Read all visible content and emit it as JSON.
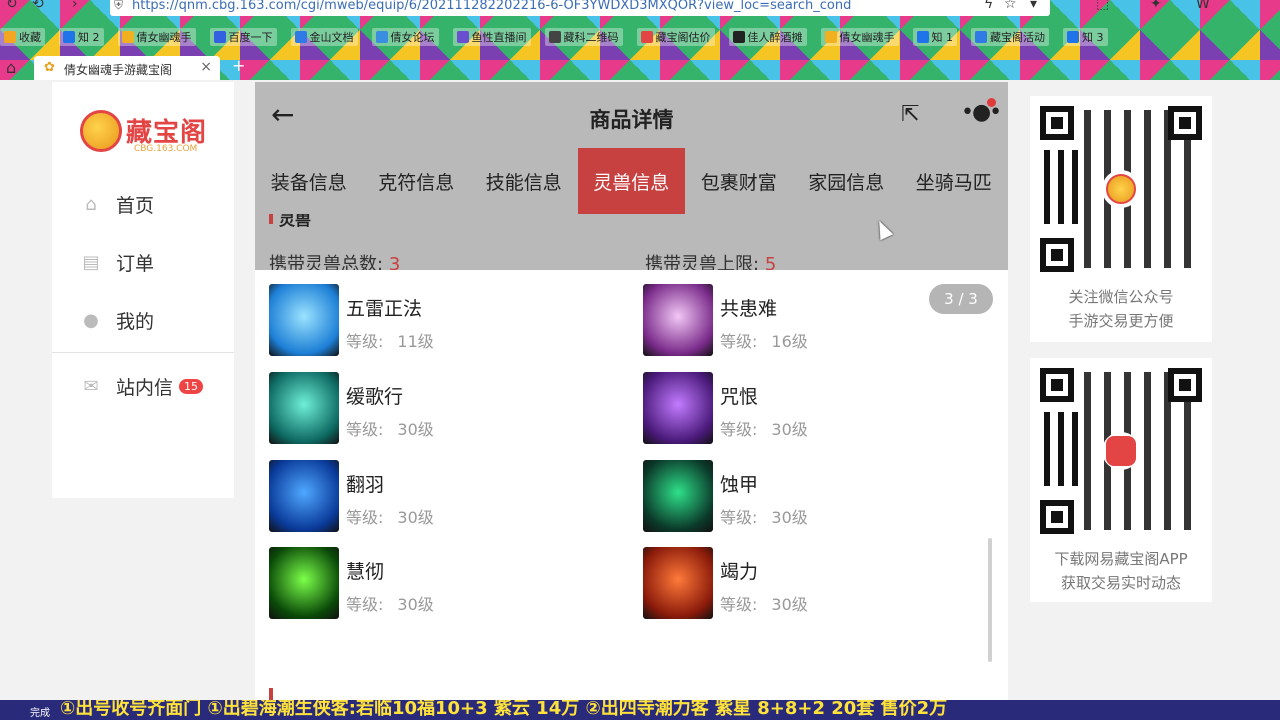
{
  "browser": {
    "url": "https://qnm.cbg.163.com/cgi/mweb/equip/6/202111282202216-6-OF3YWDXD3MXQOR?view_loc=search_cond",
    "bookmarks": [
      {
        "label": "收藏",
        "color": "#f3a623"
      },
      {
        "label": "知 2",
        "color": "#1e74e8"
      },
      {
        "label": "倩女幽魂手",
        "color": "#f0b020"
      },
      {
        "label": "百度一下",
        "color": "#3160e0"
      },
      {
        "label": "金山文档",
        "color": "#2f7ae5"
      },
      {
        "label": "倩女论坛",
        "color": "#3a8ee0"
      },
      {
        "label": "鱼性直播间",
        "color": "#6a4fd0"
      },
      {
        "label": "藏科二维码",
        "color": "#444"
      },
      {
        "label": "藏宝阁估价",
        "color": "#e34545"
      },
      {
        "label": "佳人醉酒摊",
        "color": "#222"
      },
      {
        "label": "倩女幽魂手",
        "color": "#f0b020"
      },
      {
        "label": "知 1",
        "color": "#1e74e8"
      },
      {
        "label": "藏宝阁活动",
        "color": "#2f7ae5"
      },
      {
        "label": "知 3",
        "color": "#1e74e8"
      }
    ],
    "tab_title": "倩女幽魂手游藏宝阁"
  },
  "sidebar": {
    "logo_text": "藏宝阁",
    "logo_sub": "CBG.163.COM",
    "items": [
      {
        "label": "首页",
        "icon": "home-icon"
      },
      {
        "label": "订单",
        "icon": "order-icon"
      },
      {
        "label": "我的",
        "icon": "user-icon"
      },
      {
        "label": "站内信",
        "icon": "mail-icon",
        "badge": "15"
      }
    ]
  },
  "mobile": {
    "title": "商品详情",
    "tabs": [
      "装备信息",
      "克符信息",
      "技能信息",
      "灵兽信息",
      "包裹财富",
      "家园信息",
      "坐骑马匹"
    ],
    "active_tab": "灵兽信息",
    "section_title": "灵兽",
    "stats": [
      {
        "label": "携带灵兽总数:",
        "value": "3"
      },
      {
        "label": "携带灵兽上限:",
        "value": "5"
      }
    ],
    "pager": "3 / 3",
    "level_label": "等级:",
    "skills": [
      {
        "name": "五雷正法",
        "level": "11级",
        "colors": [
          "#1d7fd6",
          "#9be3ff"
        ]
      },
      {
        "name": "共患难",
        "level": "16级",
        "colors": [
          "#7a2b8a",
          "#f2c7f5"
        ]
      },
      {
        "name": "缓歌行",
        "level": "30级",
        "colors": [
          "#0e6a63",
          "#6ff0d8"
        ]
      },
      {
        "name": "咒恨",
        "level": "30级",
        "colors": [
          "#4a1a7a",
          "#c27bff"
        ]
      },
      {
        "name": "翻羽",
        "level": "30级",
        "colors": [
          "#0a3a9a",
          "#4fa8ff"
        ]
      },
      {
        "name": "蚀甲",
        "level": "30级",
        "colors": [
          "#0b3a2a",
          "#2fe08a"
        ]
      },
      {
        "name": "慧彻",
        "level": "30级",
        "colors": [
          "#0a4a08",
          "#7cff4a"
        ]
      },
      {
        "name": "竭力",
        "level": "30级",
        "colors": [
          "#8a1a0a",
          "#ff7a3a"
        ]
      }
    ]
  },
  "qr_cards": [
    {
      "line1": "关注微信公众号",
      "line2": "手游交易更方便"
    },
    {
      "line1": "下载网易藏宝阁APP",
      "line2": "获取交易实时动态"
    }
  ],
  "ticker": {
    "status": "完成",
    "text": "①出号收号齐面门 ①出碧海潮生侠客:若临10福10+3 紫云 14万 ②出四寺潮力客 紫星 8+8+2 20套 售价2万"
  }
}
